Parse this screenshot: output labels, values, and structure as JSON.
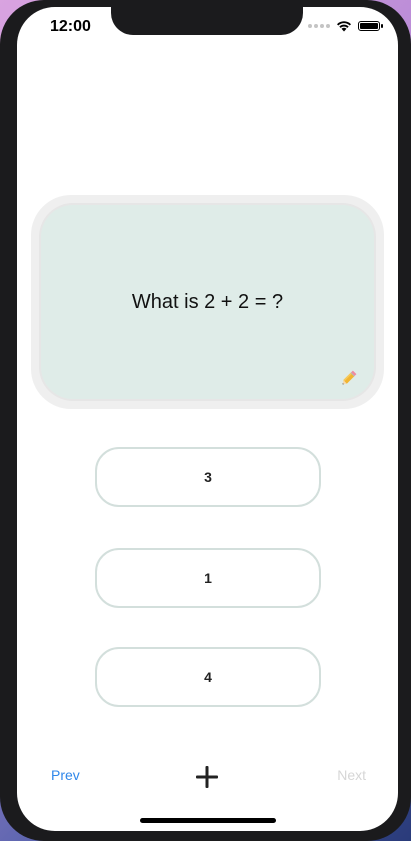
{
  "status_bar": {
    "time": "12:00",
    "icons": [
      "signal-dots-icon",
      "wifi-icon",
      "battery-icon"
    ]
  },
  "card": {
    "question": "What is 2 + 2 = ?",
    "edit_icon": "pencil-icon",
    "background_color": "#dfece8"
  },
  "answers": [
    {
      "label": "3"
    },
    {
      "label": "1"
    },
    {
      "label": "4"
    }
  ],
  "bottom_bar": {
    "prev_label": "Prev",
    "next_label": "Next",
    "add_icon": "plus-icon",
    "prev_color": "#2f87ea",
    "next_color_disabled": "#d6d6d6"
  }
}
